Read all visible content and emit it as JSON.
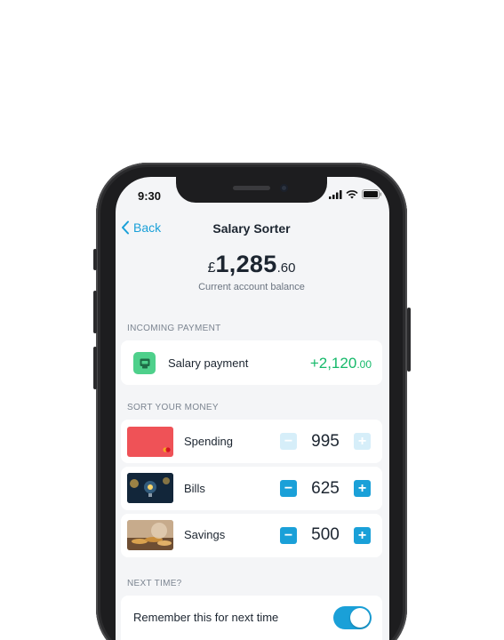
{
  "status_bar": {
    "time": "9:30"
  },
  "nav": {
    "back_label": "Back",
    "title": "Salary Sorter"
  },
  "balance": {
    "currency": "£",
    "whole": "1,285",
    "fraction": ".60",
    "label": "Current account balance"
  },
  "incoming": {
    "section_title": "INCOMING PAYMENT",
    "label": "Salary payment",
    "amount_whole": "+2,120",
    "amount_fraction": ".00"
  },
  "sort": {
    "section_title": "SORT YOUR MONEY",
    "rows": [
      {
        "label": "Spending",
        "value": "995",
        "minus": "−",
        "plus": "+"
      },
      {
        "label": "Bills",
        "value": "625",
        "minus": "−",
        "plus": "+"
      },
      {
        "label": "Savings",
        "value": "500",
        "minus": "−",
        "plus": "+"
      }
    ]
  },
  "next_time": {
    "section_title": "NEXT TIME?",
    "remember_label": "Remember this for next time",
    "remember_enabled": true
  },
  "colors": {
    "accent": "#1aa0d8",
    "positive": "#15b96a",
    "background": "#f4f5f7"
  }
}
